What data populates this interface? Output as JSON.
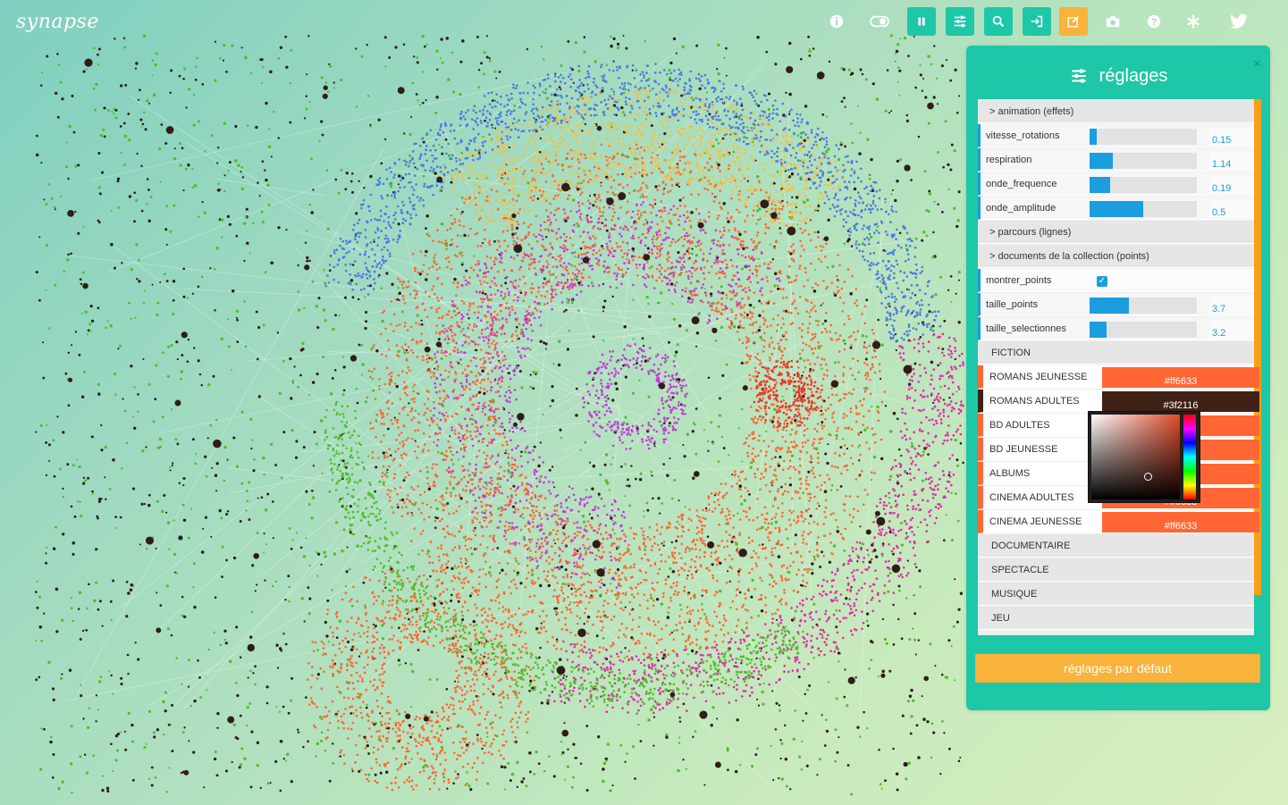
{
  "app": {
    "logo": "synapse"
  },
  "toolbar": {
    "buttons": [
      {
        "name": "info-icon",
        "style": "plain"
      },
      {
        "name": "toggle-icon",
        "style": "plain"
      },
      {
        "name": "pause-icon",
        "style": "teal"
      },
      {
        "name": "sliders-icon",
        "style": "teal"
      },
      {
        "name": "search-icon",
        "style": "teal"
      },
      {
        "name": "login-icon",
        "style": "teal"
      },
      {
        "name": "edit-icon",
        "style": "orange"
      },
      {
        "name": "camera-icon",
        "style": "plain"
      },
      {
        "name": "help-icon",
        "style": "plain"
      },
      {
        "name": "asterisk-icon",
        "style": "plain"
      },
      {
        "name": "twitter-icon",
        "style": "plain"
      }
    ]
  },
  "panel": {
    "title": "réglages",
    "close": "×",
    "reset_label": "réglages par défaut"
  },
  "gui": {
    "folder_animation": "> animation (effets)",
    "vitesse_rotations": {
      "label": "vitesse_rotations",
      "value": "0.15",
      "fraction": 0.07
    },
    "respiration": {
      "label": "respiration",
      "value": "1.14",
      "fraction": 0.22
    },
    "onde_frequence": {
      "label": "onde_frequence",
      "value": "0.19",
      "fraction": 0.19
    },
    "onde_amplitude": {
      "label": "onde_amplitude",
      "value": "0.5",
      "fraction": 0.5
    },
    "folder_parcours": "> parcours (lignes)",
    "folder_documents": "> documents de la collection (points)",
    "montrer_points": {
      "label": "montrer_points",
      "checked": true,
      "check": "✓"
    },
    "taille_points": {
      "label": "taille_points",
      "value": "3.7",
      "fraction": 0.37
    },
    "taille_selectionnes": {
      "label": "taille_selectionnes",
      "value": "3.2",
      "fraction": 0.16
    },
    "fiction": "FICTION",
    "genres": [
      {
        "label": "ROMANS JEUNESSE",
        "color": "#ff6633",
        "text": "#ff6633"
      },
      {
        "label": "ROMANS ADULTES",
        "color": "#3f2116",
        "text": "#3f2116"
      },
      {
        "label": "BD ADULTES",
        "color": "#ff6633",
        "text": ""
      },
      {
        "label": "BD JEUNESSE",
        "color": "#ff6633",
        "text": ""
      },
      {
        "label": "ALBUMS",
        "color": "#ff6633",
        "text": ""
      },
      {
        "label": "CINEMA ADULTES",
        "color": "#ff6633",
        "text": "#ff6633"
      },
      {
        "label": "CINEMA JEUNESSE",
        "color": "#ff6633",
        "text": "#ff6633"
      }
    ],
    "documentaire": "DOCUMENTAIRE",
    "spectacle": "SPECTACLE",
    "musique": "MUSIQUE",
    "jeu": "JEU"
  },
  "colors": {
    "teal": "#1ec7a8",
    "orange": "#f9b23a",
    "slider": "#1b9de0",
    "points": [
      "#2f1d16",
      "#4fbf2a",
      "#ff6633",
      "#4a7be0",
      "#f7c038",
      "#c23ad8",
      "#e22aa8",
      "#e8322a"
    ]
  }
}
